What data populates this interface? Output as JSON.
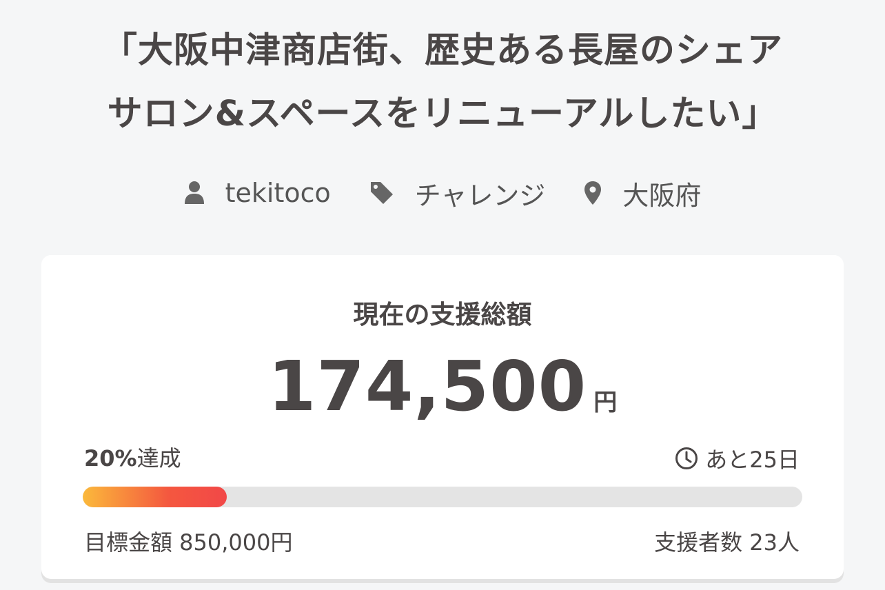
{
  "project": {
    "title_line1": "「大阪中津商店街、歴史ある長屋のシェア",
    "title_line2": "サロン&スペースをリニューアルしたい」",
    "owner": "tekitoco",
    "category": "チャレンジ",
    "location": "大阪府"
  },
  "funding": {
    "label": "現在の支援総額",
    "amount": "174,500",
    "unit": "円",
    "percent_value": "20%",
    "percent_suffix": "達成",
    "progress": 0.2,
    "remaining": "あと25日",
    "goal": "目標金額 850,000円",
    "backers": "支援者数 23人"
  },
  "icons": {
    "owner": "person-icon",
    "category": "tag-icon",
    "location": "map-pin-icon",
    "remaining": "clock-icon"
  },
  "colors": {
    "progress_start": "#fbb93b",
    "progress_end": "#f24848",
    "track": "#e4e4e4",
    "text": "#4a4646"
  }
}
